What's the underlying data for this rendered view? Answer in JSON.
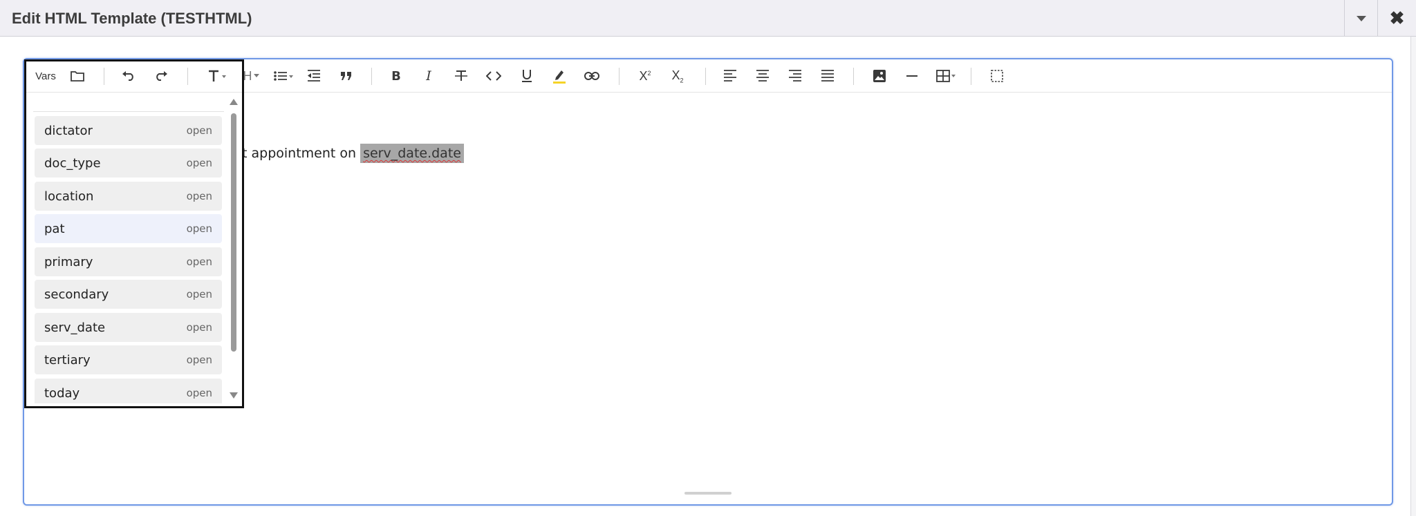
{
  "window": {
    "title": "Edit HTML Template (TESTHTML)",
    "close_glyph": "✖"
  },
  "toolbar": {
    "vars_label": "Vars",
    "heading_label": "H",
    "icons": [
      "folder-icon",
      "undo-icon",
      "redo-icon",
      "text-size-icon",
      "heading-icon",
      "bullet-list-icon",
      "outdent-icon",
      "blockquote-icon",
      "bold-icon",
      "italic-icon",
      "strikethrough-icon",
      "code-icon",
      "underline-icon",
      "highlight-icon",
      "link-icon",
      "superscript-icon",
      "subscript-icon",
      "align-left-icon",
      "align-center-icon",
      "align-right-icon",
      "align-justify-icon",
      "image-icon",
      "horizontal-rule-icon",
      "table-icon",
      "select-all-icon"
    ],
    "highlight_color": "#f5d327"
  },
  "content": {
    "text_before": "t appointment on ",
    "variable_chip": "serv_date.date"
  },
  "vars": {
    "search_value": "",
    "open_label": "open",
    "items": [
      {
        "name": "dictator"
      },
      {
        "name": "doc_type"
      },
      {
        "name": "location"
      },
      {
        "name": "pat"
      },
      {
        "name": "primary"
      },
      {
        "name": "secondary"
      },
      {
        "name": "serv_date"
      },
      {
        "name": "tertiary"
      },
      {
        "name": "today"
      }
    ]
  },
  "colors": {
    "editor_border": "#6f98e6",
    "chip_background": "#a7a7a7",
    "item_background": "#efefef",
    "item_highlight": "#eef1fb"
  }
}
